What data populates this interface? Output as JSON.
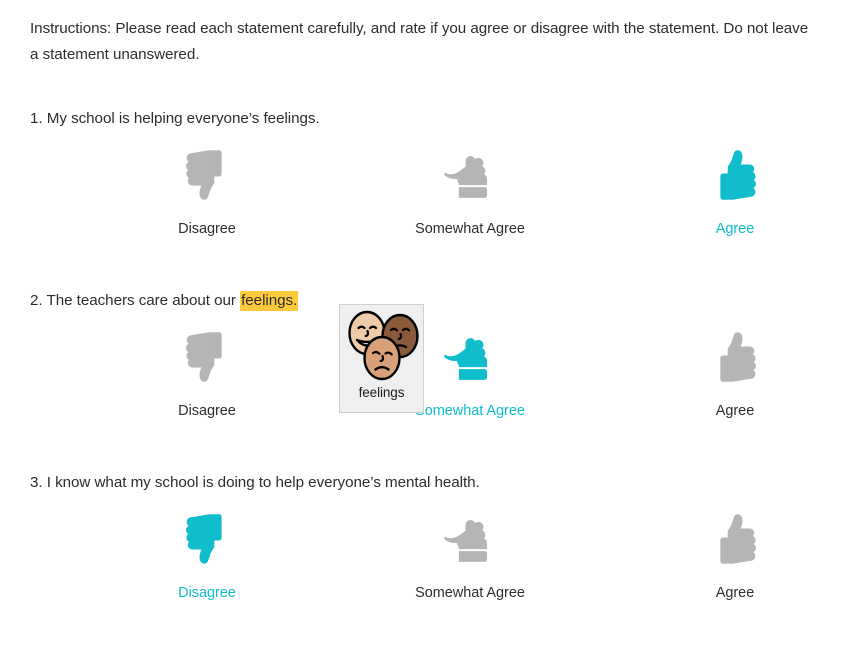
{
  "colors": {
    "selected": "#0FBDCC",
    "unselected": "#B5B5B5",
    "highlight": "#FFC93C",
    "text": "#2d2d2d",
    "card_bg": "#EFEFEF",
    "card_border": "#cfcfcf",
    "face_light": "#EFCBAA",
    "face_dark": "#8B5A3C",
    "face_medium": "#D9A178"
  },
  "instructions": "Instructions: Please read each statement carefully, and rate if you agree or disagree with the statement. Do not leave a statement unanswered.",
  "symbol_card": {
    "label": "feelings",
    "icon": "three-faces-feelings-symbol"
  },
  "questions": [
    {
      "number": "1.",
      "text_before": "My school is helping everyone’s feelings.",
      "highlighted_word": "",
      "text_after": "",
      "selected_index": 2,
      "options": [
        {
          "label": "Disagree",
          "icon": "thumbs-down-icon"
        },
        {
          "label": "Somewhat Agree",
          "icon": "fist-sideways-icon"
        },
        {
          "label": "Agree",
          "icon": "thumbs-up-icon"
        }
      ]
    },
    {
      "number": "2.",
      "text_before": "The teachers care about our ",
      "highlighted_word": "feelings.",
      "text_after": "",
      "selected_index": 1,
      "options": [
        {
          "label": "Disagree",
          "icon": "thumbs-down-icon"
        },
        {
          "label": "Somewhat Agree",
          "icon": "fist-sideways-icon"
        },
        {
          "label": "Agree",
          "icon": "thumbs-up-icon"
        }
      ]
    },
    {
      "number": "3.",
      "text_before": "I know what my school is doing to help everyone’s mental health.",
      "highlighted_word": "",
      "text_after": "",
      "selected_index": 0,
      "options": [
        {
          "label": "Disagree",
          "icon": "thumbs-down-icon"
        },
        {
          "label": "Somewhat Agree",
          "icon": "fist-sideways-icon"
        },
        {
          "label": "Agree",
          "icon": "thumbs-up-icon"
        }
      ]
    }
  ]
}
